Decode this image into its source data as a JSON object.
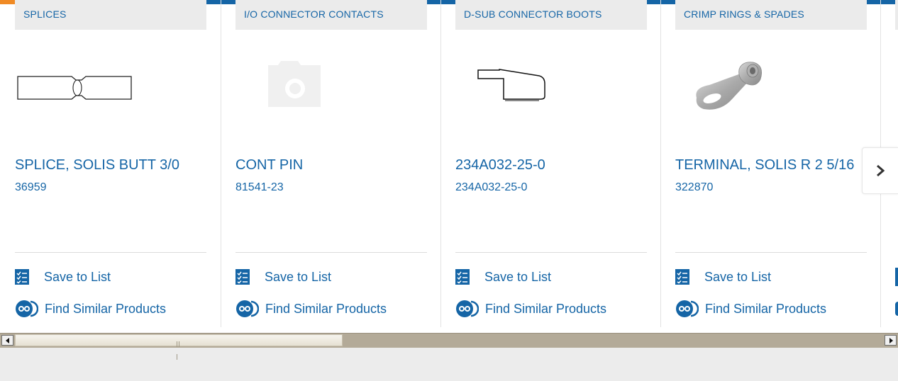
{
  "carousel": {
    "cards": [
      {
        "category": "SPLICES",
        "image": "splice-butt-drawing",
        "title": "SPLICE, SOLIS BUTT 3/0",
        "part": "36959",
        "save_label": "Save to List",
        "similar_label": "Find Similar Products"
      },
      {
        "category": "I/O CONNECTOR CONTACTS",
        "image": "camera-placeholder-icon",
        "title": "CONT PIN",
        "part": "81541-23",
        "save_label": "Save to List",
        "similar_label": "Find Similar Products"
      },
      {
        "category": "D-SUB CONNECTOR BOOTS",
        "image": "dsub-boot-drawing",
        "title": "234A032-25-0",
        "part": "234A032-25-0",
        "save_label": "Save to List",
        "similar_label": "Find Similar Products"
      },
      {
        "category": "CRIMP RINGS & SPADES",
        "image": "ring-terminal-photo",
        "title": "TERMINAL, SOLIS R 2 5/16",
        "part": "322870",
        "save_label": "Save to List",
        "similar_label": "Find Similar Products"
      }
    ],
    "next_icon": "chevron-right-icon"
  },
  "scrollbar": {
    "left_icon": "arrow-left-icon",
    "right_icon": "arrow-right-icon"
  },
  "colors": {
    "link": "#1565a6",
    "tab_bg": "#ebebeb",
    "top_bar": "#1565a6",
    "top_bar_accent": "#f08a24",
    "page_bg": "#ececec"
  }
}
